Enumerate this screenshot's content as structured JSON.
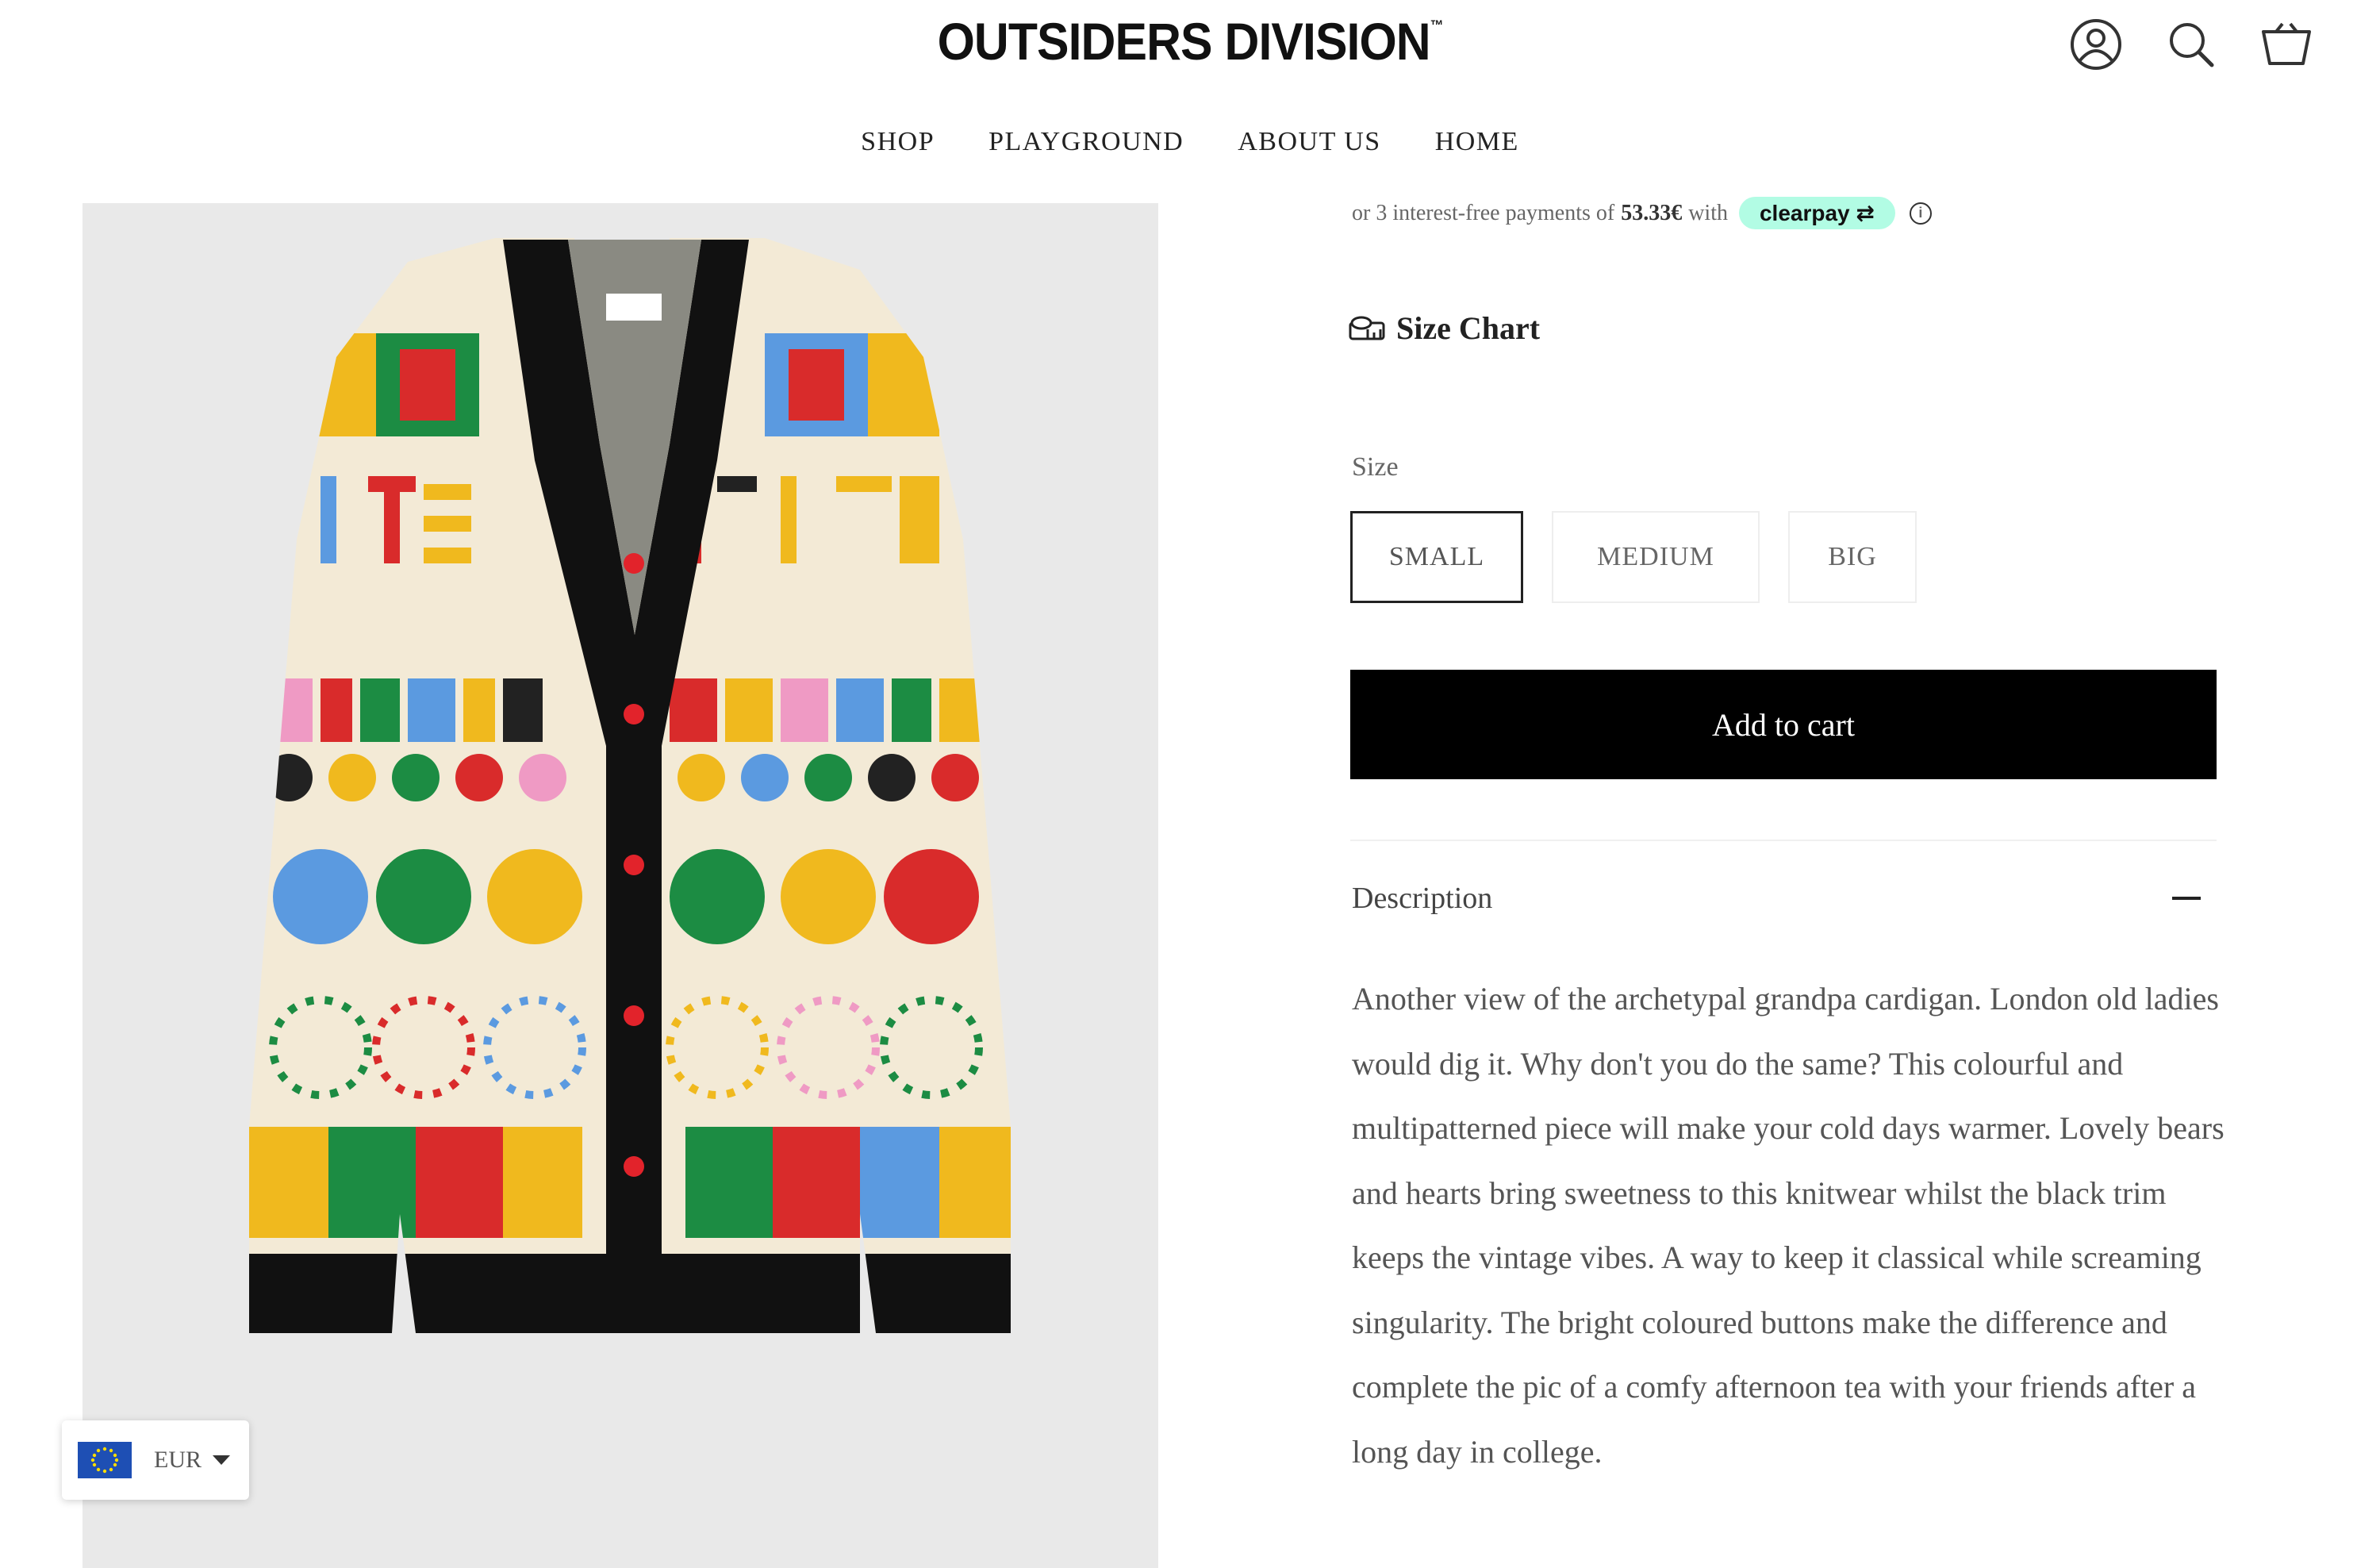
{
  "header": {
    "brand": "OUTSIDERS DIVISION",
    "trademark": "™",
    "icons": [
      "account-icon",
      "search-icon",
      "cart-icon"
    ]
  },
  "nav": {
    "items": [
      "SHOP",
      "PLAYGROUND",
      "ABOUT US",
      "HOME"
    ]
  },
  "payments": {
    "prefix": "or 3 interest-free payments of",
    "amount": "53.33€",
    "with": "with",
    "provider": "clearpay",
    "provider_color": "#b2fce4"
  },
  "size_chart": {
    "label": "Size Chart"
  },
  "size": {
    "label": "Size",
    "options": [
      "SMALL",
      "MEDIUM",
      "BIG"
    ],
    "selected": "SMALL"
  },
  "add_to_cart": {
    "label": "Add to cart"
  },
  "description": {
    "title": "Description",
    "text": "Another view of the archetypal grandpa cardigan. London old ladies would dig it. Why don't you do the same? This colourful and multipatterned piece will make your cold days warmer. Lovely bears and hearts bring sweetness to this knitwear whilst the black trim keeps the vintage vibes. A way to keep it classical while screaming singularity. The bright coloured buttons make the difference and complete the pic of a comfy afternoon tea with your friends after a long day in college."
  },
  "currency": {
    "code": "EUR",
    "flag": "eu-flag-icon"
  }
}
